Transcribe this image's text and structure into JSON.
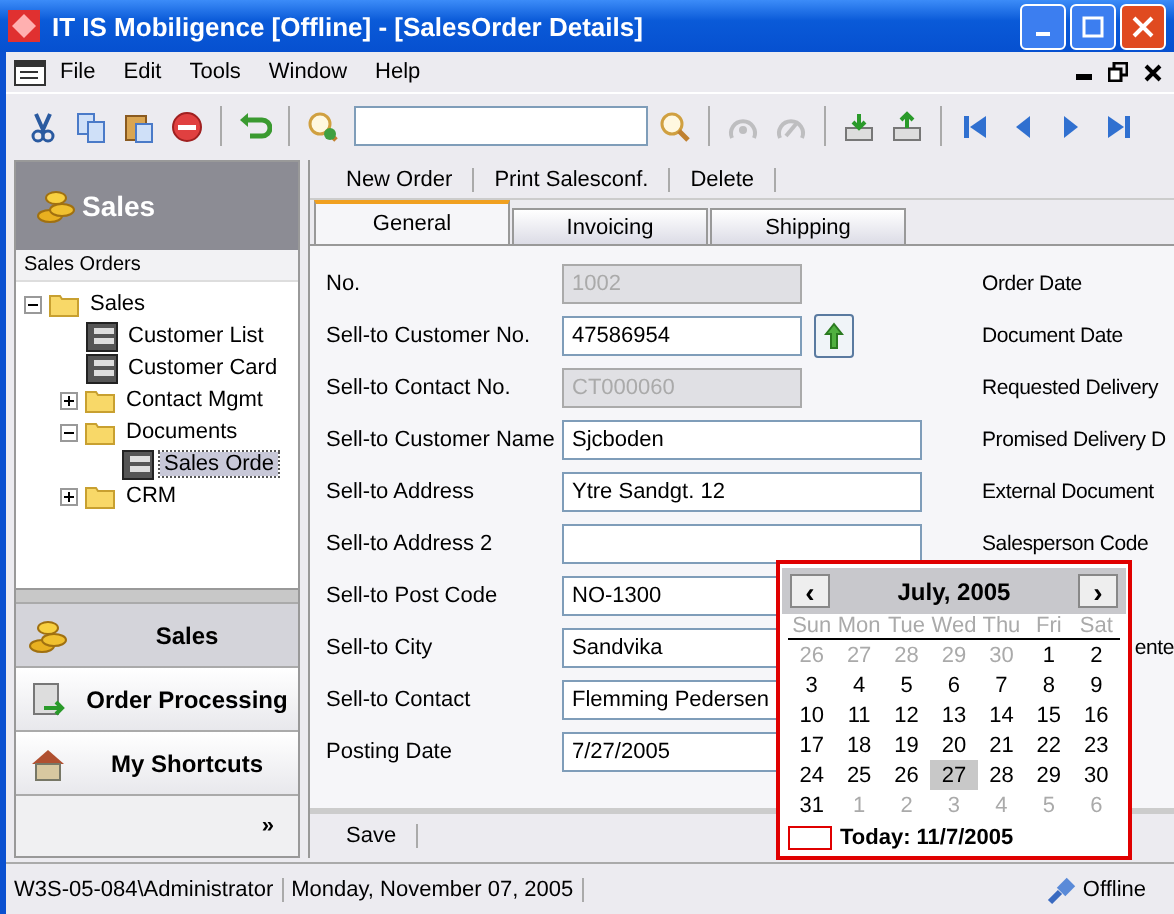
{
  "window": {
    "title": "IT IS Mobiligence [Offline] - [SalesOrder Details]"
  },
  "menu": [
    "File",
    "Edit",
    "Tools",
    "Window",
    "Help"
  ],
  "toolbar": {
    "buttons": [
      {
        "disabled": false
      },
      {
        "disabled": false
      },
      {
        "disabled": false
      },
      {
        "disabled": false
      },
      {
        "disabled": false
      },
      {
        "disabled": false
      }
    ],
    "right_buttons": [
      {
        "disabled": false
      },
      {
        "disabled": true
      },
      {
        "disabled": true
      },
      {
        "disabled": false
      },
      {
        "disabled": false
      },
      {
        "disabled": false
      },
      {
        "disabled": false
      },
      {
        "disabled": false
      },
      {
        "disabled": false
      }
    ]
  },
  "sidebar": {
    "header": "Sales",
    "section": "Sales Orders",
    "tree": [
      {
        "label": "Sales",
        "kind": "folder",
        "expanded": true,
        "selected": false,
        "children": [
          {
            "label": "Customer List",
            "kind": "form",
            "selected": false
          },
          {
            "label": "Customer Card",
            "kind": "form",
            "selected": false
          },
          {
            "label": "Contact Mgmt",
            "kind": "folder",
            "expanded": false,
            "selected": false
          },
          {
            "label": "Documents",
            "kind": "folder",
            "expanded": true,
            "selected": false,
            "children": [
              {
                "label": "Sales Orde",
                "kind": "form",
                "selected": true
              }
            ]
          },
          {
            "label": "CRM",
            "kind": "folder",
            "expanded": false,
            "selected": false
          }
        ]
      }
    ],
    "nav": [
      {
        "label": "Sales",
        "selected": true
      },
      {
        "label": "Order Processing",
        "selected": false
      },
      {
        "label": "My Shortcuts",
        "selected": false
      }
    ],
    "more": "»"
  },
  "commands": [
    "New Order",
    "Print Salesconf.",
    "Delete"
  ],
  "tabs": [
    {
      "label": "General",
      "selected": true
    },
    {
      "label": "Invoicing",
      "selected": false
    },
    {
      "label": "Shipping",
      "selected": false
    }
  ],
  "form": [
    {
      "label": "No.",
      "value": "1002",
      "kind": "code",
      "disabled": true,
      "right_label": "Order Date"
    },
    {
      "label": "Sell-to Customer No.",
      "value": "47586954",
      "kind": "code",
      "disabled": false,
      "lookup": true,
      "right_label": "Document Date"
    },
    {
      "label": "Sell-to Contact No.",
      "value": "CT000060",
      "kind": "code",
      "disabled": true,
      "right_label": "Requested Delivery"
    },
    {
      "label": "Sell-to Customer Name",
      "value": "Sjcboden",
      "kind": "text",
      "disabled": false,
      "right_label": "Promised Delivery D"
    },
    {
      "label": "Sell-to Address",
      "value": "Ytre Sandgt. 12",
      "kind": "text",
      "disabled": false,
      "right_label": "External Document"
    },
    {
      "label": "Sell-to Address 2",
      "kind": "text",
      "disabled": false,
      "right_label": "Salesperson Code"
    },
    {
      "label": "Sell-to Post Code",
      "value": "NO-1300",
      "kind": "text",
      "disabled": false
    },
    {
      "label": "Sell-to City",
      "value": "Sandvika",
      "kind": "text",
      "disabled": false,
      "right_label": "ente",
      "covered": true
    },
    {
      "label": "Sell-to Contact",
      "value": "Flemming Pedersen",
      "kind": "text",
      "disabled": false
    },
    {
      "label": "Posting Date",
      "value": "7/27/2005",
      "kind": "text",
      "disabled": false
    }
  ],
  "save_bar": [
    "Save"
  ],
  "calendar": {
    "month": "July, 2005",
    "prev": "‹",
    "next": "›",
    "weekdays": [
      "Sun",
      "Mon",
      "Tue",
      "Wed",
      "Thu",
      "Fri",
      "Sat"
    ],
    "days": [
      {
        "day": "26",
        "muted": true,
        "selected": false
      },
      {
        "day": "27",
        "muted": true,
        "selected": false
      },
      {
        "day": "28",
        "muted": true,
        "selected": false
      },
      {
        "day": "29",
        "muted": true,
        "selected": false
      },
      {
        "day": "30",
        "muted": true,
        "selected": false
      },
      {
        "day": "1",
        "muted": false,
        "selected": false
      },
      {
        "day": "2",
        "muted": false,
        "selected": false
      },
      {
        "day": "3",
        "muted": false,
        "selected": false
      },
      {
        "day": "4",
        "muted": false,
        "selected": false
      },
      {
        "day": "5",
        "muted": false,
        "selected": false
      },
      {
        "day": "6",
        "muted": false,
        "selected": false
      },
      {
        "day": "7",
        "muted": false,
        "selected": false
      },
      {
        "day": "8",
        "muted": false,
        "selected": false
      },
      {
        "day": "9",
        "muted": false,
        "selected": false
      },
      {
        "day": "10",
        "muted": false,
        "selected": false
      },
      {
        "day": "11",
        "muted": false,
        "selected": false
      },
      {
        "day": "12",
        "muted": false,
        "selected": false
      },
      {
        "day": "13",
        "muted": false,
        "selected": false
      },
      {
        "day": "14",
        "muted": false,
        "selected": false
      },
      {
        "day": "15",
        "muted": false,
        "selected": false
      },
      {
        "day": "16",
        "muted": false,
        "selected": false
      },
      {
        "day": "17",
        "muted": false,
        "selected": false
      },
      {
        "day": "18",
        "muted": false,
        "selected": false
      },
      {
        "day": "19",
        "muted": false,
        "selected": false
      },
      {
        "day": "20",
        "muted": false,
        "selected": false
      },
      {
        "day": "21",
        "muted": false,
        "selected": false
      },
      {
        "day": "22",
        "muted": false,
        "selected": false
      },
      {
        "day": "23",
        "muted": false,
        "selected": false
      },
      {
        "day": "24",
        "muted": false,
        "selected": false
      },
      {
        "day": "25",
        "muted": false,
        "selected": false
      },
      {
        "day": "26",
        "muted": false,
        "selected": false
      },
      {
        "day": "27",
        "muted": false,
        "selected": true
      },
      {
        "day": "28",
        "muted": false,
        "selected": false
      },
      {
        "day": "29",
        "muted": false,
        "selected": false
      },
      {
        "day": "30",
        "muted": false,
        "selected": false
      },
      {
        "day": "31",
        "muted": false,
        "selected": false
      },
      {
        "day": "1",
        "muted": true,
        "selected": false
      },
      {
        "day": "2",
        "muted": true,
        "selected": false
      },
      {
        "day": "3",
        "muted": true,
        "selected": false
      },
      {
        "day": "4",
        "muted": true,
        "selected": false
      },
      {
        "day": "5",
        "muted": true,
        "selected": false
      },
      {
        "day": "6",
        "muted": true,
        "selected": false
      }
    ],
    "today": "Today: 11/7/2005"
  },
  "status_bar": {
    "user": "W3S-05-084\\Administrator",
    "date": "Monday, November 07, 2005",
    "connection": "Offline"
  }
}
